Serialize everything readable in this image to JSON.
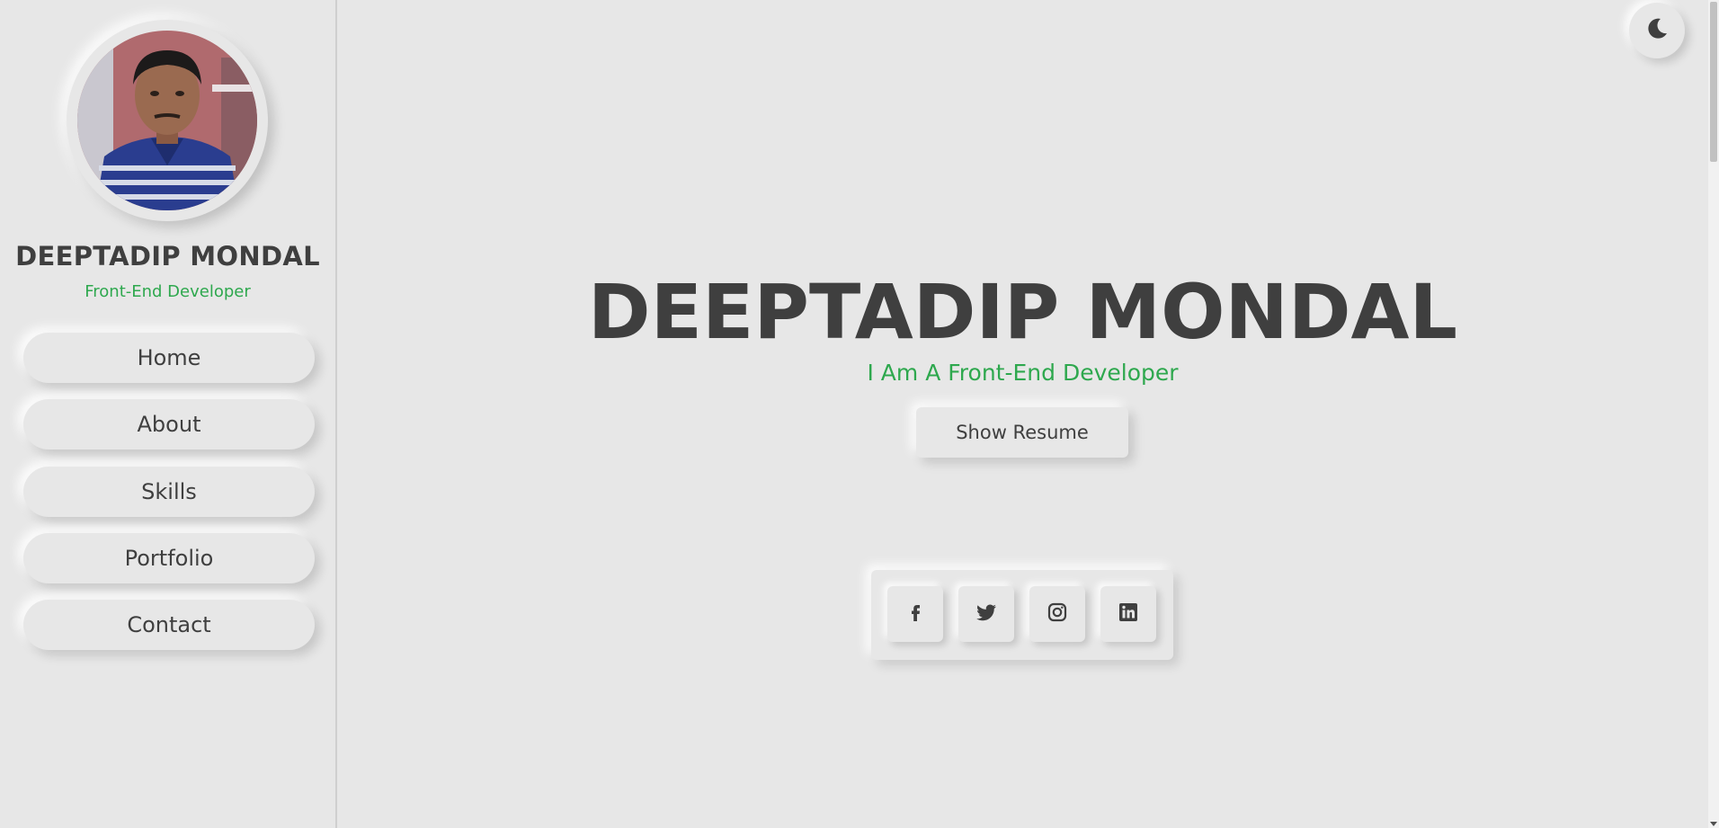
{
  "sidebar": {
    "name": "DEEPTADIP MONDAL",
    "role": "Front-End Developer",
    "nav": [
      {
        "label": "Home"
      },
      {
        "label": "About"
      },
      {
        "label": "Skills"
      },
      {
        "label": "Portfolio"
      },
      {
        "label": "Contact"
      }
    ]
  },
  "hero": {
    "name": "DEEPTADIP MONDAL",
    "role": "I Am A Front-End Developer",
    "resume_label": "Show Resume"
  },
  "social": {
    "icons": [
      "facebook-icon",
      "twitter-icon",
      "instagram-icon",
      "linkedin-icon"
    ]
  },
  "theme_toggle": {
    "icon": "moon-icon"
  },
  "colors": {
    "background": "#e7e7e7",
    "accent": "#2ea84e",
    "text": "#3f3f3f"
  }
}
